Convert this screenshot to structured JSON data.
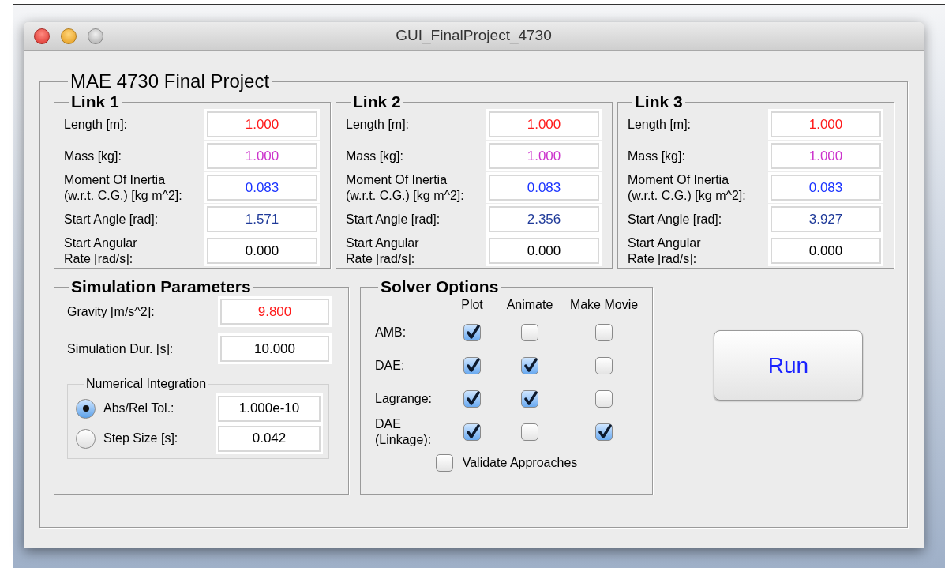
{
  "window": {
    "title": "GUI_FinalProject_4730"
  },
  "panel": {
    "title": "MAE 4730 Final Project"
  },
  "links": [
    {
      "title": "Link 1",
      "fields": [
        {
          "label": "Length [m]:",
          "value": "1.000",
          "color": "#ff1a1a"
        },
        {
          "label": "Mass [kg]:",
          "value": "1.000",
          "color": "#cc33cc"
        },
        {
          "label": "Moment Of Inertia\n(w.r.t. C.G.) [kg m^2]:",
          "value": "0.083",
          "color": "#1a33ff"
        },
        {
          "label": "Start Angle [rad]:",
          "value": "1.571",
          "color": "#1f3a99"
        },
        {
          "label": "Start Angular\nRate [rad/s]:",
          "value": "0.000",
          "color": "#000000"
        }
      ]
    },
    {
      "title": "Link 2",
      "fields": [
        {
          "label": "Length [m]:",
          "value": "1.000",
          "color": "#ff1a1a"
        },
        {
          "label": "Mass [kg]:",
          "value": "1.000",
          "color": "#cc33cc"
        },
        {
          "label": "Moment Of Inertia\n(w.r.t. C.G.) [kg m^2]:",
          "value": "0.083",
          "color": "#1a33ff"
        },
        {
          "label": "Start Angle [rad]:",
          "value": "2.356",
          "color": "#1f3a99"
        },
        {
          "label": "Start Angular\nRate [rad/s]:",
          "value": "0.000",
          "color": "#000000"
        }
      ]
    },
    {
      "title": "Link 3",
      "fields": [
        {
          "label": "Length [m]:",
          "value": "1.000",
          "color": "#ff1a1a"
        },
        {
          "label": "Mass [kg]:",
          "value": "1.000",
          "color": "#cc33cc"
        },
        {
          "label": "Moment Of Inertia\n(w.r.t. C.G.) [kg m^2]:",
          "value": "0.083",
          "color": "#1a33ff"
        },
        {
          "label": "Start Angle [rad]:",
          "value": "3.927",
          "color": "#1f3a99"
        },
        {
          "label": "Start Angular\nRate [rad/s]:",
          "value": "0.000",
          "color": "#000000"
        }
      ]
    }
  ],
  "simulation": {
    "title": "Simulation Parameters",
    "fields": [
      {
        "label": "Gravity [m/s^2]:",
        "value": "9.800",
        "color": "#ff1a1a"
      },
      {
        "label": "Simulation Dur. [s]:",
        "value": "10.000",
        "color": "#000000"
      }
    ],
    "integration": {
      "title": "Numerical Integration",
      "options": [
        {
          "label": "Abs/Rel Tol.:",
          "value": "1.000e-10",
          "selected": true
        },
        {
          "label": "Step Size [s]:",
          "value": "0.042",
          "selected": false
        }
      ]
    }
  },
  "solver": {
    "title": "Solver Options",
    "columns": [
      "Plot",
      "Animate",
      "Make Movie"
    ],
    "rows": [
      {
        "label": "AMB:",
        "checks": [
          true,
          false,
          false
        ]
      },
      {
        "label": "DAE:",
        "checks": [
          true,
          true,
          false
        ]
      },
      {
        "label": "Lagrange:",
        "checks": [
          true,
          true,
          false
        ]
      },
      {
        "label": "DAE\n(Linkage):",
        "checks": [
          true,
          false,
          true
        ]
      }
    ],
    "validate": {
      "label": "Validate Approaches",
      "checked": false
    }
  },
  "run_button": {
    "label": "Run"
  }
}
